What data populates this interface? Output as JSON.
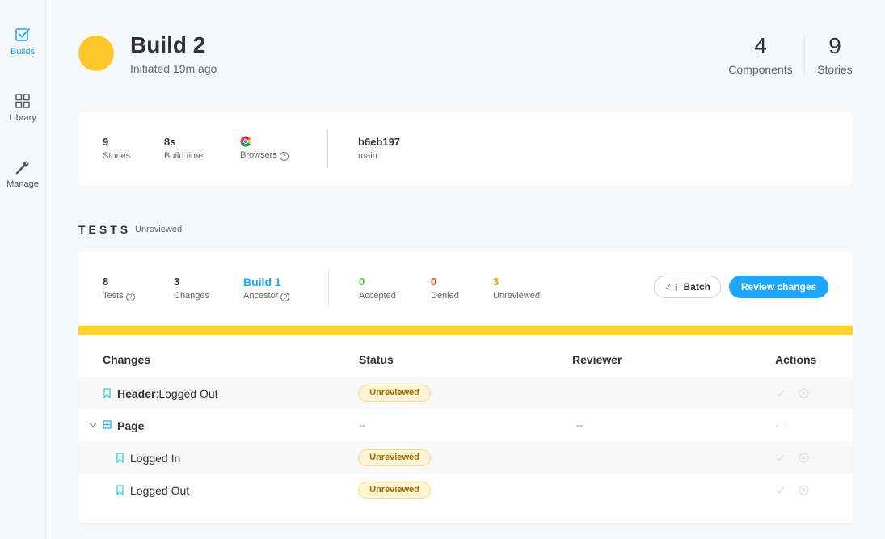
{
  "sidebar": {
    "items": [
      {
        "label": "Builds",
        "icon": "builds-icon",
        "active": true
      },
      {
        "label": "Library",
        "icon": "library-icon",
        "active": false
      },
      {
        "label": "Manage",
        "icon": "wrench-icon",
        "active": false
      }
    ]
  },
  "header": {
    "title": "Build 2",
    "subtitle": "Initiated 19m ago",
    "status_color": "#ffc72c",
    "stats": [
      {
        "value": "4",
        "label": "Components"
      },
      {
        "value": "9",
        "label": "Stories"
      }
    ]
  },
  "build_info": {
    "stories": {
      "value": "9",
      "label": "Stories"
    },
    "build_time": {
      "value": "8s",
      "label": "Build time"
    },
    "browsers": {
      "label": "Browsers",
      "icon": "chrome-icon"
    },
    "commit": {
      "value": "b6eb197",
      "label": "main"
    }
  },
  "tests": {
    "title": "TESTS",
    "status": "Unreviewed",
    "stats": {
      "tests": {
        "value": "8",
        "label": "Tests"
      },
      "changes": {
        "value": "3",
        "label": "Changes"
      },
      "ancestor": {
        "value": "Build 1",
        "label": "Ancestor"
      },
      "accepted": {
        "value": "0",
        "label": "Accepted",
        "color": "#66bf3c"
      },
      "denied": {
        "value": "0",
        "label": "Denied",
        "color": "#ff4400"
      },
      "unreviewed": {
        "value": "3",
        "label": "Unreviewed",
        "color": "#e69d00"
      }
    },
    "batch_label": "Batch",
    "review_label": "Review changes",
    "progress_color": "#fdd22e"
  },
  "table": {
    "headers": {
      "changes": "Changes",
      "status": "Status",
      "reviewer": "Reviewer",
      "actions": "Actions"
    },
    "rows": [
      {
        "component": "Header",
        "story": "Logged Out",
        "status": "Unreviewed"
      },
      {
        "component": "Page",
        "status": "--",
        "reviewer": "--"
      },
      {
        "story": "Logged In",
        "status": "Unreviewed"
      },
      {
        "story": "Logged Out",
        "status": "Unreviewed"
      }
    ]
  }
}
